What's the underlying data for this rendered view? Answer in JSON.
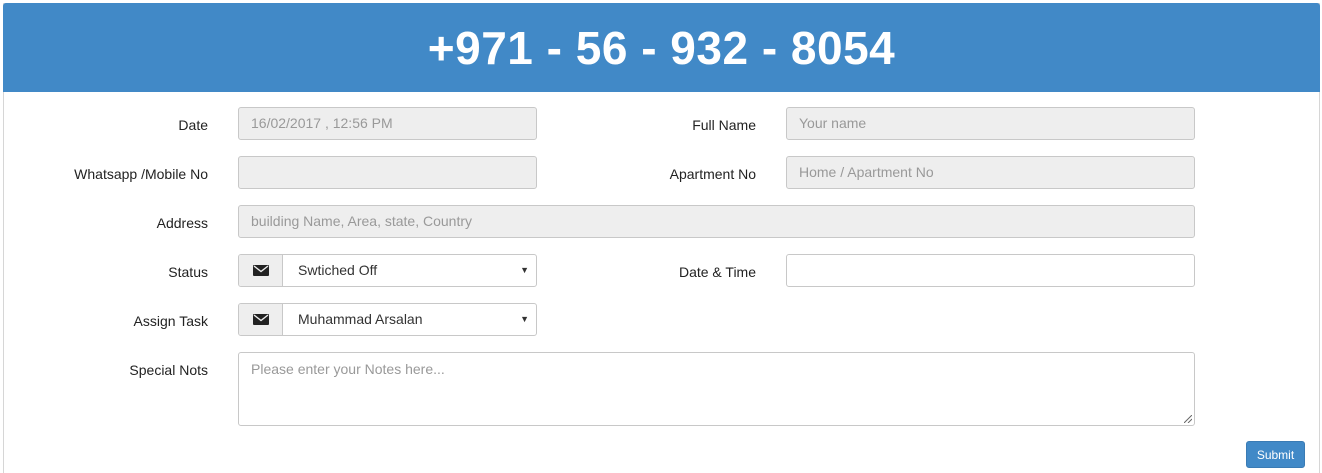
{
  "header": {
    "phone": "+971 - 56 - 932 - 8054"
  },
  "form": {
    "date": {
      "label": "Date",
      "value": "16/02/2017 , 12:56 PM"
    },
    "full_name": {
      "label": "Full Name",
      "placeholder": "Your name"
    },
    "mobile": {
      "label": "Whatsapp /Mobile No",
      "value": ""
    },
    "apartment": {
      "label": "Apartment No",
      "placeholder": "Home / Apartment No"
    },
    "address": {
      "label": "Address",
      "placeholder": "building Name, Area, state, Country"
    },
    "status": {
      "label": "Status",
      "selected": "Swtiched Off",
      "icon": "envelope-icon"
    },
    "datetime": {
      "label": "Date & Time",
      "value": ""
    },
    "assign_task": {
      "label": "Assign Task",
      "selected": "Muhammad Arsalan",
      "icon": "envelope-icon"
    },
    "notes": {
      "label": "Special Nots",
      "placeholder": "Please enter your Notes here..."
    },
    "submit_label": "Submit"
  },
  "colors": {
    "primary": "#4189c7",
    "input_bg": "#eeeeee"
  }
}
